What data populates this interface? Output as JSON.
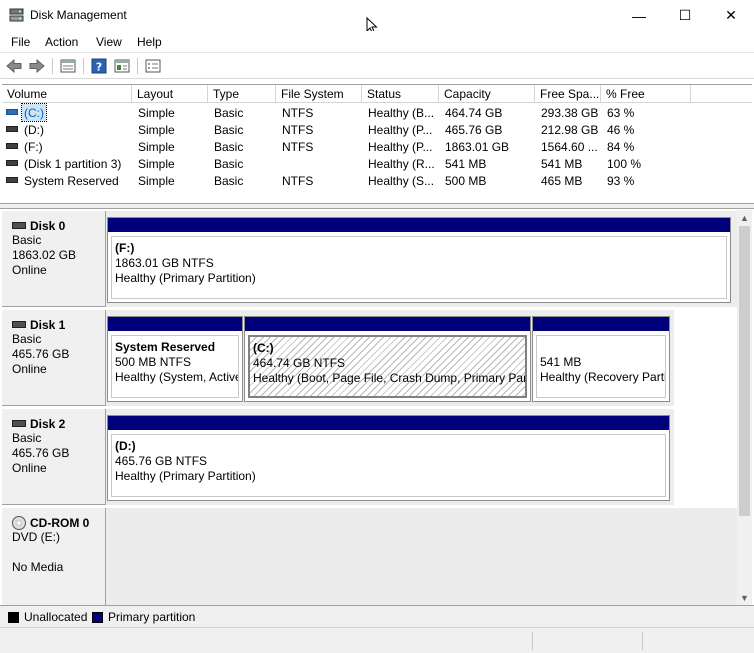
{
  "window": {
    "title": "Disk Management",
    "min_glyph": "—",
    "max_glyph": "☐",
    "close_glyph": "✕"
  },
  "menu": [
    "File",
    "Action",
    "View",
    "Help"
  ],
  "toolbar": {
    "icons": [
      "back-arrow-icon",
      "forward-arrow-icon",
      "properties-list-icon",
      "help-icon",
      "console-tree-icon",
      "settings-list-icon"
    ]
  },
  "volumes": {
    "columns": [
      "Volume",
      "Layout",
      "Type",
      "File System",
      "Status",
      "Capacity",
      "Free Spa...",
      "% Free"
    ],
    "rows": [
      {
        "volume": "(C:)",
        "layout": "Simple",
        "type": "Basic",
        "fs": "NTFS",
        "status": "Healthy (B...",
        "capacity": "464.74 GB",
        "free": "293.38 GB",
        "pct": "63 %"
      },
      {
        "volume": "(D:)",
        "layout": "Simple",
        "type": "Basic",
        "fs": "NTFS",
        "status": "Healthy (P...",
        "capacity": "465.76 GB",
        "free": "212.98 GB",
        "pct": "46 %"
      },
      {
        "volume": "(F:)",
        "layout": "Simple",
        "type": "Basic",
        "fs": "NTFS",
        "status": "Healthy (P...",
        "capacity": "1863.01 GB",
        "free": "1564.60 ...",
        "pct": "84 %"
      },
      {
        "volume": "(Disk 1 partition 3)",
        "layout": "Simple",
        "type": "Basic",
        "fs": "",
        "status": "Healthy (R...",
        "capacity": "541 MB",
        "free": "541 MB",
        "pct": "100 %"
      },
      {
        "volume": "System Reserved",
        "layout": "Simple",
        "type": "Basic",
        "fs": "NTFS",
        "status": "Healthy (S...",
        "capacity": "500 MB",
        "free": "465 MB",
        "pct": "93 %"
      }
    ]
  },
  "disks": [
    {
      "name": "Disk 0",
      "kind": "Basic",
      "size": "1863.02 GB",
      "state": "Online",
      "partitions": [
        {
          "label": "(F:)",
          "size": "1863.01 GB NTFS",
          "status": "Healthy (Primary Partition)"
        }
      ]
    },
    {
      "name": "Disk 1",
      "kind": "Basic",
      "size": "465.76 GB",
      "state": "Online",
      "partitions": [
        {
          "label": "System Reserved",
          "size": "500 MB NTFS",
          "status": "Healthy (System, Active"
        },
        {
          "label": "(C:)",
          "size": "464.74 GB NTFS",
          "status": "Healthy (Boot, Page File, Crash Dump, Primary Partit"
        },
        {
          "label": "",
          "size": "541 MB",
          "status": "Healthy (Recovery Parti"
        }
      ]
    },
    {
      "name": "Disk 2",
      "kind": "Basic",
      "size": "465.76 GB",
      "state": "Online",
      "partitions": [
        {
          "label": "(D:)",
          "size": "465.76 GB NTFS",
          "status": "Healthy (Primary Partition)"
        }
      ]
    },
    {
      "name": "CD-ROM 0",
      "kind": "DVD (E:)",
      "size": "",
      "state": "No Media",
      "partitions": []
    }
  ],
  "legend": [
    {
      "label": "Unallocated",
      "color": "#000000"
    },
    {
      "label": "Primary partition",
      "color": "#00007b"
    }
  ],
  "colors": {
    "partition_bar": "#00007b",
    "selection": "#cce4f7"
  }
}
